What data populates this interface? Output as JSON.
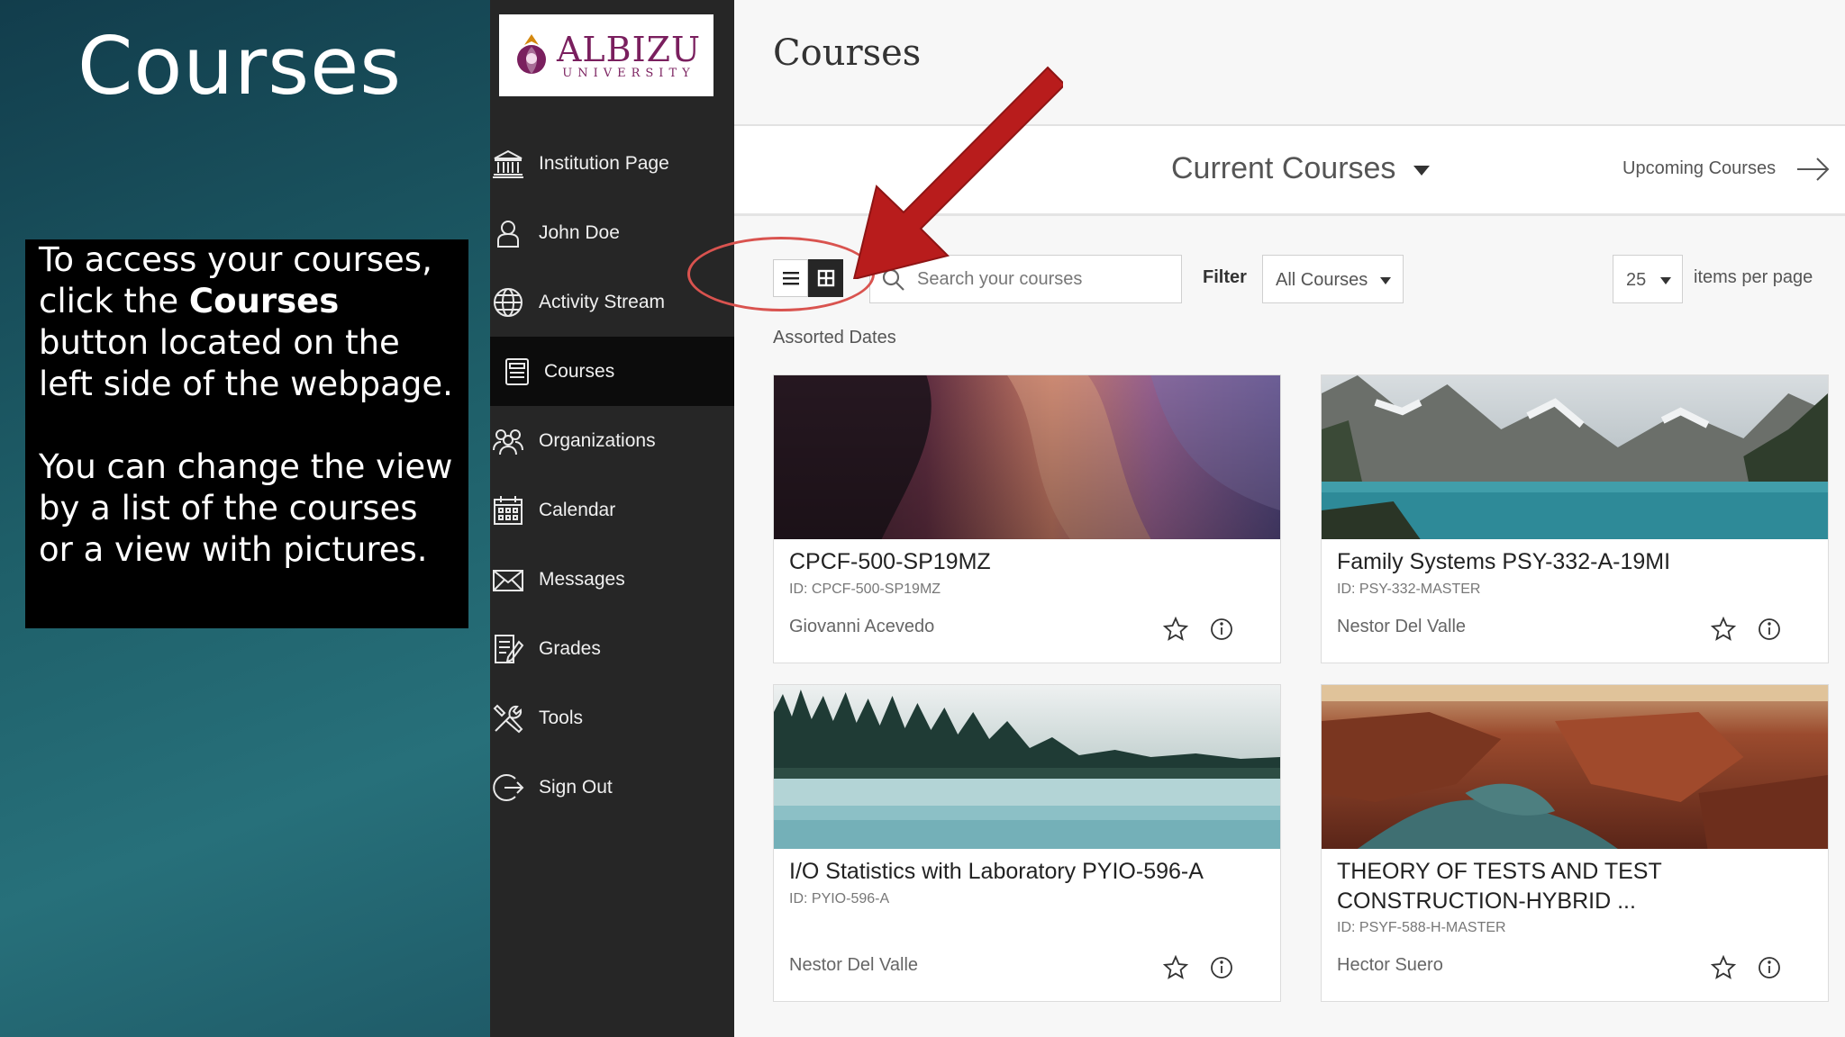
{
  "slide": {
    "title": "Courses",
    "instruction_line1": "To access your courses, click the ",
    "instruction_bold": "Courses",
    "instruction_line1_end": " button located on the left side of the webpage.",
    "instruction_para2": "You can change the view by a list of the courses or a view with pictures."
  },
  "logo": {
    "name": "ALBIZU",
    "sub": "UNIVERSITY"
  },
  "sidebar": {
    "items": [
      {
        "label": "Institution Page",
        "icon": "institution-icon"
      },
      {
        "label": "John Doe",
        "icon": "user-icon"
      },
      {
        "label": "Activity Stream",
        "icon": "globe-icon"
      },
      {
        "label": "Courses",
        "icon": "courses-icon",
        "active": true
      },
      {
        "label": "Organizations",
        "icon": "organizations-icon"
      },
      {
        "label": "Calendar",
        "icon": "calendar-icon"
      },
      {
        "label": "Messages",
        "icon": "envelope-icon"
      },
      {
        "label": "Grades",
        "icon": "grades-icon"
      },
      {
        "label": "Tools",
        "icon": "tools-icon"
      },
      {
        "label": "Sign Out",
        "icon": "sign-out-icon"
      }
    ]
  },
  "main": {
    "title": "Courses",
    "term": "Current Courses",
    "upcoming": "Upcoming Courses",
    "search_placeholder": "Search your courses",
    "filter_label": "Filter",
    "filter_value": "All Courses",
    "per_page_value": "25",
    "per_page_label": "items per page",
    "date_group": "Assorted Dates"
  },
  "courses": [
    {
      "title": "CPCF-500-SP19MZ",
      "id": "ID: CPCF-500-SP19MZ",
      "instructor": "Giovanni Acevedo"
    },
    {
      "title": "Family Systems PSY-332-A-19MI",
      "id": "ID: PSY-332-MASTER",
      "instructor": "Nestor Del Valle"
    },
    {
      "title": "I/O Statistics with Laboratory PYIO-596-A",
      "id": "ID: PYIO-596-A",
      "instructor": "Nestor Del Valle"
    },
    {
      "title": "THEORY OF TESTS AND TEST CONSTRUCTION-HYBRID ...",
      "id": "ID: PSYF-588-H-MASTER",
      "instructor": "Hector Suero"
    }
  ],
  "colors": {
    "sidebar_bg": "#262626",
    "active_item_bg": "#0c0c0c",
    "logo_purple": "#7a1f5e",
    "annotation_red": "#b81c1c",
    "annotation_circle": "#d9534f"
  }
}
